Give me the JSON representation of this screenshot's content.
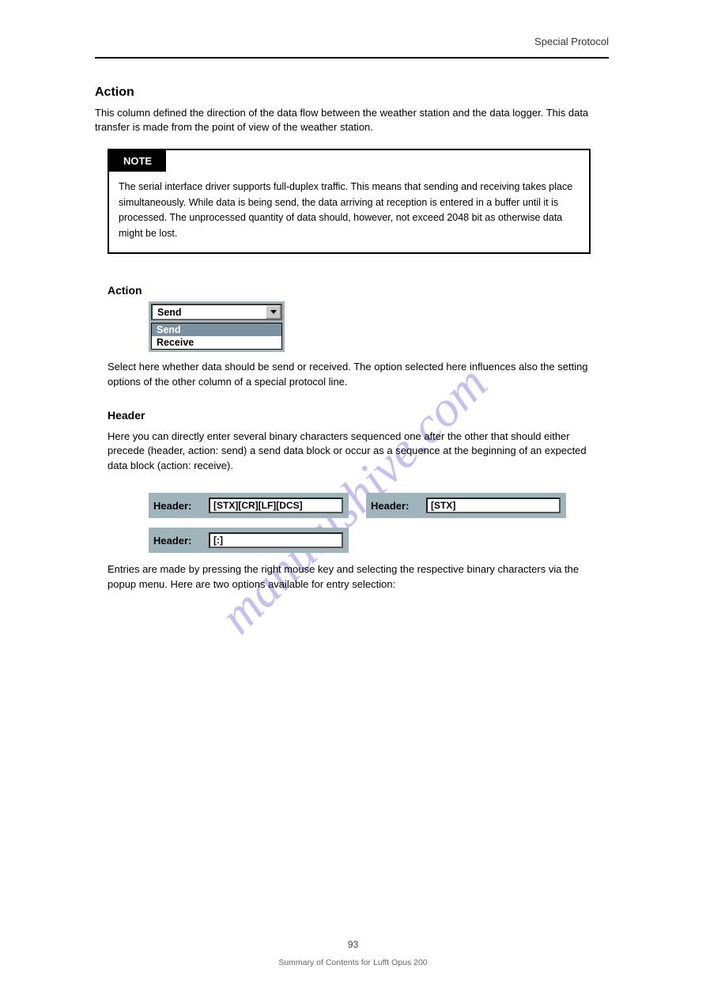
{
  "header": {
    "right_text": "Special Protocol"
  },
  "section_title": "Action",
  "intro": "This column defined the direction of the data flow between the weather station and the data logger. This data transfer is made from the point of view of the weather station.",
  "callout": {
    "label": "NOTE",
    "body": "The serial interface driver supports full-duplex traffic. This means that sending and receiving takes place simultaneously. While data is being send, the data arriving at reception is entered in a buffer until it is processed. The unprocessed quantity of data should, however, not exceed 2048 bit as otherwise data might be lost."
  },
  "action_field": {
    "label": "Action",
    "closed_value": "Send",
    "options": [
      "Send",
      "Receive"
    ],
    "selected_index": 0,
    "desc": "Select here whether data should be send or received. The option selected here influences also the setting options of the other column of a special protocol line."
  },
  "header_field": {
    "label": "Header",
    "widget_label": "Header:",
    "para1": "Here you can directly enter several binary characters sequenced one after the other that should either precede (header, action: send) a send data block or occur as a sequence at the beginning of an expected data block (action: receive).",
    "examples": [
      {
        "value": "[STX][CR][LF][DCS]"
      },
      {
        "value": "[STX]"
      },
      {
        "value": "[:]"
      }
    ],
    "para2": "Entries are made by pressing the right mouse key and selecting the respective binary characters via the popup menu. Here are two options available for entry selection:"
  },
  "watermark": "manualshive.com",
  "footer": {
    "page": "93",
    "line": "Summary of Contents for Lufft Opus 200"
  }
}
